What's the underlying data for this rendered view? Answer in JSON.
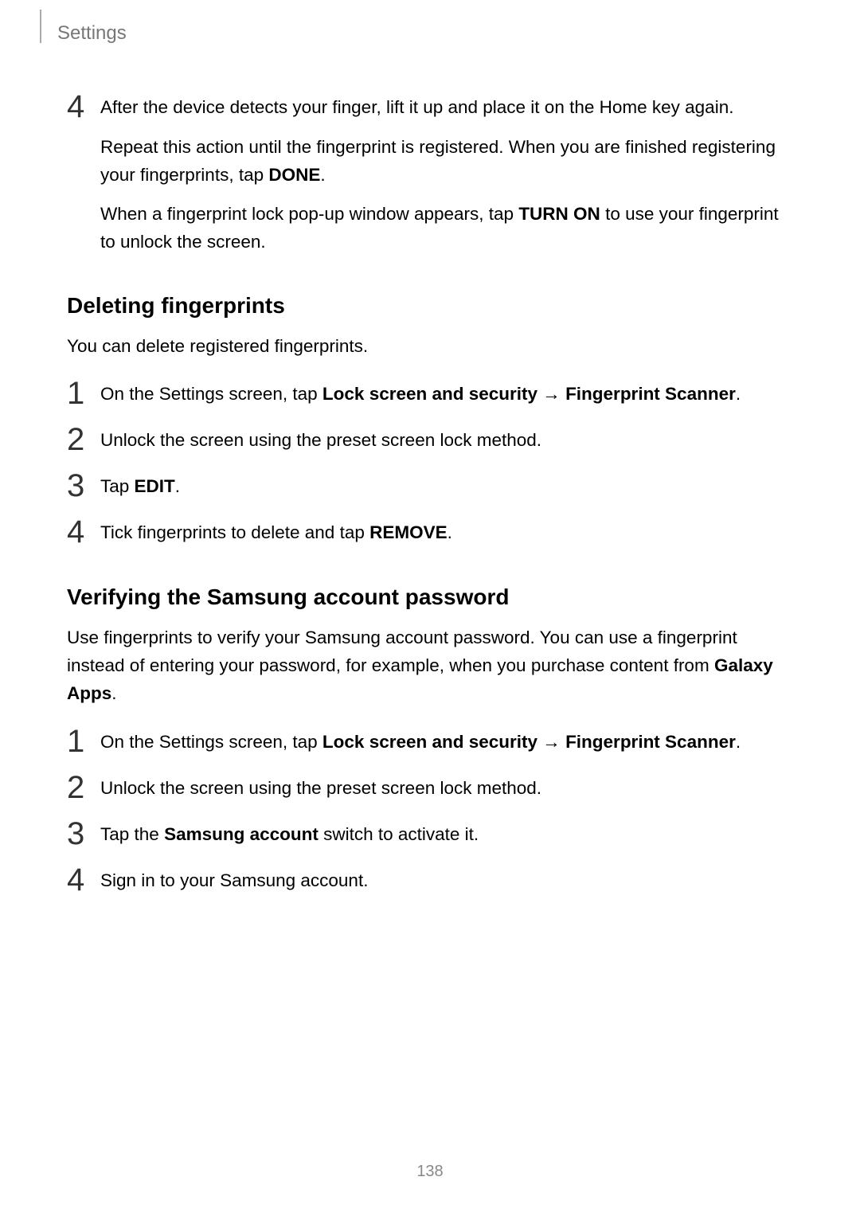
{
  "header": {
    "title": "Settings"
  },
  "step4_block": {
    "number": "4",
    "line1": "After the device detects your finger, lift it up and place it on the Home key again.",
    "line2_part1": "Repeat this action until the fingerprint is registered. When you are finished registering your fingerprints, tap ",
    "line2_bold": "DONE",
    "line2_part2": ".",
    "line3_part1": "When a fingerprint lock pop-up window appears, tap ",
    "line3_bold": "TURN ON",
    "line3_part2": " to use your fingerprint to unlock the screen."
  },
  "section1": {
    "heading": "Deleting fingerprints",
    "intro": "You can delete registered fingerprints.",
    "steps": [
      {
        "number": "1",
        "pre": "On the Settings screen, tap ",
        "bold1": "Lock screen and security",
        "arrow": " → ",
        "bold2": "Fingerprint Scanner",
        "post": "."
      },
      {
        "number": "2",
        "plain": "Unlock the screen using the preset screen lock method."
      },
      {
        "number": "3",
        "pre": "Tap ",
        "bold1": "EDIT",
        "post": "."
      },
      {
        "number": "4",
        "pre": "Tick fingerprints to delete and tap ",
        "bold1": "REMOVE",
        "post": "."
      }
    ]
  },
  "section2": {
    "heading": "Verifying the Samsung account password",
    "intro_part1": "Use fingerprints to verify your Samsung account password. You can use a fingerprint instead of entering your password, for example, when you purchase content from ",
    "intro_bold": "Galaxy Apps",
    "intro_part2": ".",
    "steps": [
      {
        "number": "1",
        "pre": "On the Settings screen, tap ",
        "bold1": "Lock screen and security",
        "arrow": " → ",
        "bold2": "Fingerprint Scanner",
        "post": "."
      },
      {
        "number": "2",
        "plain": "Unlock the screen using the preset screen lock method."
      },
      {
        "number": "3",
        "pre": "Tap the ",
        "bold1": "Samsung account",
        "post": " switch to activate it."
      },
      {
        "number": "4",
        "plain": "Sign in to your Samsung account."
      }
    ]
  },
  "page_number": "138"
}
